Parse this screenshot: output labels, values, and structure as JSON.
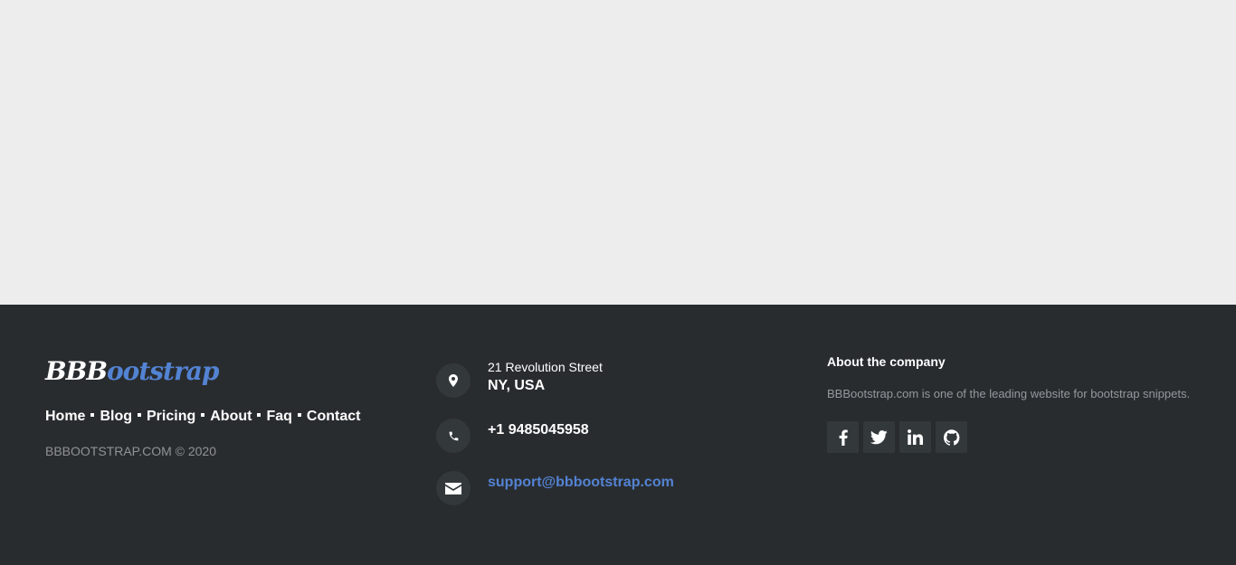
{
  "brand": {
    "logo_part1": "BBB",
    "logo_part2": "ootstrap",
    "logo_color": "#5383d3"
  },
  "footer_nav": {
    "items": [
      {
        "label": "Home"
      },
      {
        "label": "Blog"
      },
      {
        "label": "Pricing"
      },
      {
        "label": "About"
      },
      {
        "label": "Faq"
      },
      {
        "label": "Contact"
      }
    ]
  },
  "copyright": "BBBOOTSTRAP.COM © 2020",
  "contact": {
    "address_line1": "21 Revolution Street",
    "address_line2": "NY, USA",
    "phone": "+1 9485045958",
    "email": "support@bbbootstrap.com",
    "icons": [
      "map-marker-icon",
      "phone-icon",
      "envelope-icon"
    ]
  },
  "about": {
    "title": "About the company",
    "text": "BBBootstrap.com is one of the leading website for bootstrap snippets.",
    "socials": [
      {
        "name": "facebook-icon"
      },
      {
        "name": "twitter-icon"
      },
      {
        "name": "linkedin-icon"
      },
      {
        "name": "github-icon"
      }
    ]
  },
  "colors": {
    "background_top": "#ededed",
    "footer_bg": "#292c2f",
    "accent": "#5383d3",
    "icon_bg": "#33383b"
  }
}
